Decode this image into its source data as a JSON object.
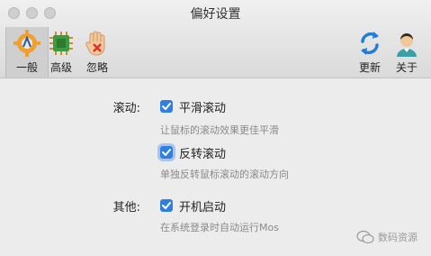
{
  "window": {
    "title": "偏好设置"
  },
  "toolbar": {
    "general_label": "一般",
    "advanced_label": "高级",
    "ignore_label": "忽略",
    "update_label": "更新",
    "about_label": "关于"
  },
  "settings": {
    "scroll_label": "滚动:",
    "smooth_scroll": {
      "label": "平滑滚动",
      "desc": "让鼠标的滚动效果更佳平滑",
      "checked": true
    },
    "reverse_scroll": {
      "label": "反转滚动",
      "desc": "单独反转鼠标滚动的滚动方向",
      "checked": true
    },
    "other_label": "其他:",
    "launch_at_login": {
      "label": "开机启动",
      "desc": "在系统登录时自动运行Mos",
      "checked": true
    }
  },
  "watermark": {
    "text": "数码资源"
  },
  "colors": {
    "accent": "#2f7fe0",
    "toolbar_bg": "#e2e2e2",
    "window_bg": "#ececec"
  }
}
